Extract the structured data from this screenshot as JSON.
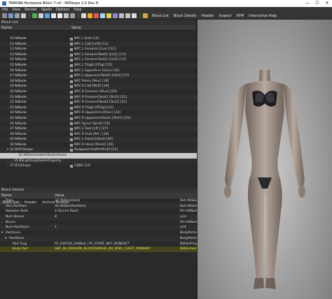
{
  "window": {
    "title": "TAMOBA Nordplate Bikini 7.nif - NifSkope 2.0 Dev 8",
    "minimize": "—",
    "maximize": "☐",
    "close": "✕"
  },
  "menu": [
    "File",
    "View",
    "Render",
    "Spells",
    "Options",
    "Help"
  ],
  "toolbar": {
    "block_list": "Block List",
    "block_details": "Block Details",
    "header": "Header",
    "inspect": "Inspect",
    "kfm": "KFM",
    "interactive_help": "Interactive Help"
  },
  "block_list": {
    "panel_title": "Block List",
    "columns": [
      "Name",
      "Value"
    ],
    "rows": [
      {
        "name": "10 NiNode",
        "value": "NPC L Butt [10]"
      },
      {
        "name": "11 NiNode",
        "value": "NPC L Calf [LClf] [11]"
      },
      {
        "name": "12 NiNode",
        "value": "NPC L Forearm [LLar] [12]"
      },
      {
        "name": "13 NiNode",
        "value": "NPC L ForearmTwist1 [LLt1] [13]"
      },
      {
        "name": "14 NiNode",
        "value": "NPC L ForearmTwist2 [LLt2] [14]"
      },
      {
        "name": "15 NiNode",
        "value": "NPC L Thigh [LThg] [15]"
      },
      {
        "name": "16 NiNode",
        "value": "NPC L UpperArm [LUar] [16]"
      },
      {
        "name": "17 NiNode",
        "value": "NPC L UpperarmTwist1 [LUt1] [17]"
      },
      {
        "name": "18 NiNode",
        "value": "NPC Pelvis [Pelv] [18]"
      },
      {
        "name": "19 NiNode",
        "value": "NPC R Calf [RClf] [19]"
      },
      {
        "name": "20 NiNode",
        "value": "NPC R Forearm [RLar] [20]"
      },
      {
        "name": "21 NiNode",
        "value": "NPC R ForearmTwist1 [RLt1] [21]"
      },
      {
        "name": "22 NiNode",
        "value": "NPC R ForearmTwist2 [RLt2] [22]"
      },
      {
        "name": "23 NiNode",
        "value": "NPC R Thigh [RThg] [23]"
      },
      {
        "name": "24 NiNode",
        "value": "NPC R UpperArm [RUar] [24]"
      },
      {
        "name": "25 NiNode",
        "value": "NPC R UpperarmTwist1 [RUt1] [25]"
      },
      {
        "name": "26 NiNode",
        "value": "NPC Spine [Spn0] [26]"
      },
      {
        "name": "27 NiNode",
        "value": "NPC L Foot [Lft ] [27]"
      },
      {
        "name": "28 NiNode",
        "value": "NPC R Foot [Rft ] [28]"
      },
      {
        "name": "29 NiNode",
        "value": "NPC L Hand [LHnd] [29]"
      },
      {
        "name": "30 NiNode",
        "value": "NPC R Hand [RHnd] [30]"
      },
      {
        "name": "31 BSTriShape",
        "value": "Redguard Outfit:00.00 [31]",
        "expand": "▾"
      },
      {
        "name": "32 BSDismemberSkinInstance",
        "value": "",
        "selected": true,
        "indent": 2
      },
      {
        "name": "35 BSLightingShaderProperty",
        "value": "",
        "expand": "›",
        "indent": 1
      },
      {
        "name": "37 BTriShape",
        "value": "CBBE [32]",
        "expand": "›"
      }
    ]
  },
  "tabs": [
    "Block List",
    "Header",
    "Archive Browser"
  ],
  "block_details": {
    "panel_title": "Block Details",
    "columns": [
      "Name",
      "Value",
      ""
    ],
    "rows": [
      {
        "name": "Data",
        "value": "33 [NiSkinData]",
        "type": "Ref<NiSkinDat"
      },
      {
        "name": "Skin Partition",
        "value": "34 [NiSkinPartition]",
        "type": "Ref<NiSkinPart"
      },
      {
        "name": "Skeleton Root",
        "value": "0 (Scene Root)",
        "type": "Ptr<NiNode>"
      },
      {
        "name": "Num Bones",
        "value": "8",
        "type": "uint"
      },
      {
        "name": "Bones",
        "value": "",
        "type": "Ptr<NiNode>",
        "expand": "›"
      },
      {
        "name": "Num Partitions",
        "value": "1",
        "type": "uint"
      },
      {
        "name": "Partitions",
        "value": "",
        "type": "BodyPartList",
        "expand": "▾"
      },
      {
        "name": "Partitions",
        "value": "",
        "type": "BodyPartList",
        "expand": "▾",
        "indent": 1
      },
      {
        "name": "Part Flag",
        "value": "PF_EDITOR_VISIBLE | PF_START_NET_BONESET",
        "type": "BSPartFlag",
        "indent": 2
      },
      {
        "name": "Body Part",
        "value": "SBP_46_DRAGON_BLOODWINGR_OR_MOD_CHEST_PRIMARY",
        "type": "BSDismemb",
        "indent": 2,
        "highlight": true
      }
    ]
  },
  "viewport": {
    "label": "3D render viewport"
  }
}
